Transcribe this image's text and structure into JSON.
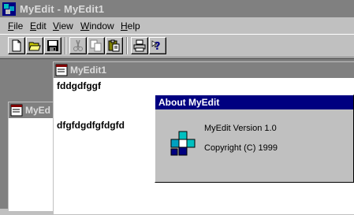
{
  "window": {
    "title": "MyEdit - MyEdit1"
  },
  "menu": [
    {
      "underline": "F",
      "rest": "ile"
    },
    {
      "underline": "E",
      "rest": "dit"
    },
    {
      "underline": "V",
      "rest": "iew"
    },
    {
      "underline": "W",
      "rest": "indow"
    },
    {
      "underline": "H",
      "rest": "elp"
    }
  ],
  "toolbar": {
    "buttons": [
      "new-icon",
      "open-icon",
      "save-icon",
      "cut-icon",
      "copy-icon",
      "paste-icon",
      "print-icon",
      "help-icon"
    ]
  },
  "documents": {
    "back": {
      "title": "MyEd"
    },
    "front": {
      "title": "MyEdit1",
      "lines": [
        "fddgdfggf",
        "dfgfdgdfgfdgfd"
      ]
    }
  },
  "about_dialog": {
    "title": "About MyEdit",
    "version": "MyEdit Version 1.0",
    "copyright": "Copyright (C) 1999"
  }
}
